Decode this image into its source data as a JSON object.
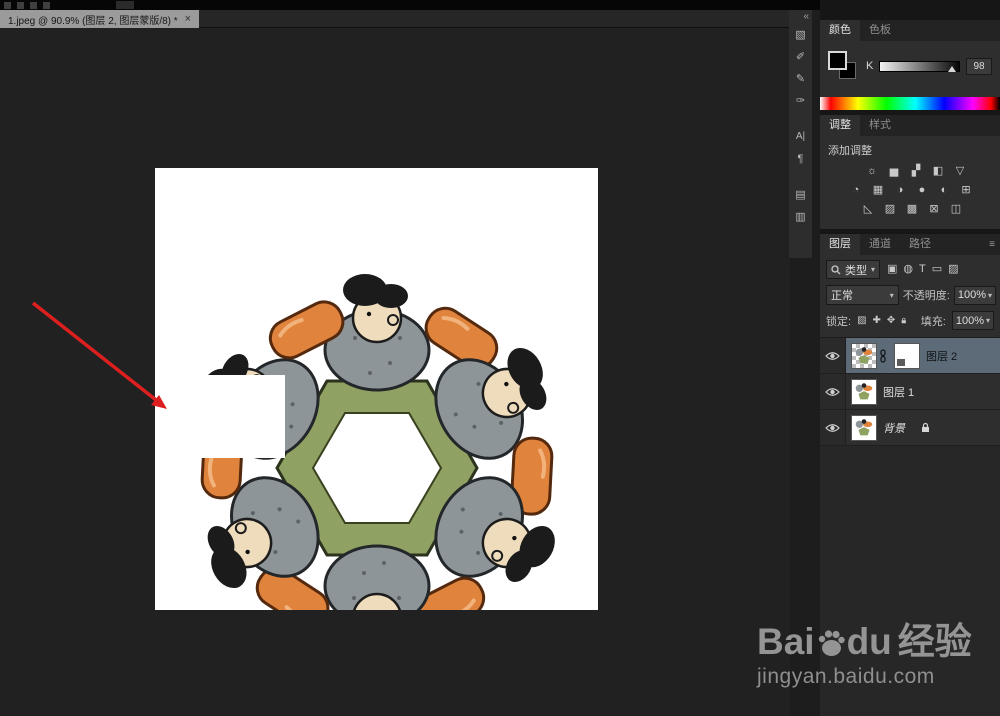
{
  "window": {
    "tab_title": "1.jpeg @ 90.9% (图层 2, 图层蒙版/8) *",
    "tab_close": "×",
    "collapse_glyph": "«"
  },
  "tools": {
    "glyphs": [
      "▧",
      "✐",
      "✎",
      "✑",
      "A|",
      "¶",
      "▤",
      "▥"
    ]
  },
  "color_panel": {
    "tab_color": "颜色",
    "tab_swatches": "色板",
    "k_label": "K",
    "k_value": "98"
  },
  "adjust_panel": {
    "tab_adjust": "调整",
    "tab_styles": "样式",
    "title": "添加调整",
    "row1": [
      "☼",
      "▅",
      "▞",
      "◧",
      "▽"
    ],
    "row2": [
      "◔",
      "▦",
      "◑",
      "●",
      "◐",
      "⊞"
    ],
    "row3": [
      "◺",
      "▨",
      "▩",
      "⊠",
      "◫"
    ]
  },
  "layers_panel": {
    "tab_layers": "图层",
    "tab_channels": "通道",
    "tab_paths": "路径",
    "menu_glyph": "≡",
    "filter_label": "类型",
    "filter_icons": [
      "▣",
      "◍",
      "T",
      "▭",
      "▨"
    ],
    "blend_mode": "正常",
    "dropdown_glyph": "▾",
    "opacity_label": "不透明度:",
    "opacity_value": "100%",
    "lock_label": "锁定:",
    "lock_icons": [
      "▨",
      "✚",
      "✥"
    ],
    "fill_label": "填充:",
    "fill_value": "100%",
    "layers": [
      {
        "name": "图层 2",
        "selected": true,
        "has_mask": true
      },
      {
        "name": "图层 1",
        "selected": false
      },
      {
        "name": "背景",
        "selected": false,
        "locked": true
      }
    ]
  },
  "watermark": {
    "bai": "Bai",
    "du": "du",
    "suffix": "经验",
    "url": "jingyan.baidu.com"
  },
  "colors": {
    "arrow": "#de1f1f",
    "selected_layer_bg": "#5c6b77",
    "canvas_bg": "#212121",
    "panel_bg": "#2e2e2e"
  }
}
